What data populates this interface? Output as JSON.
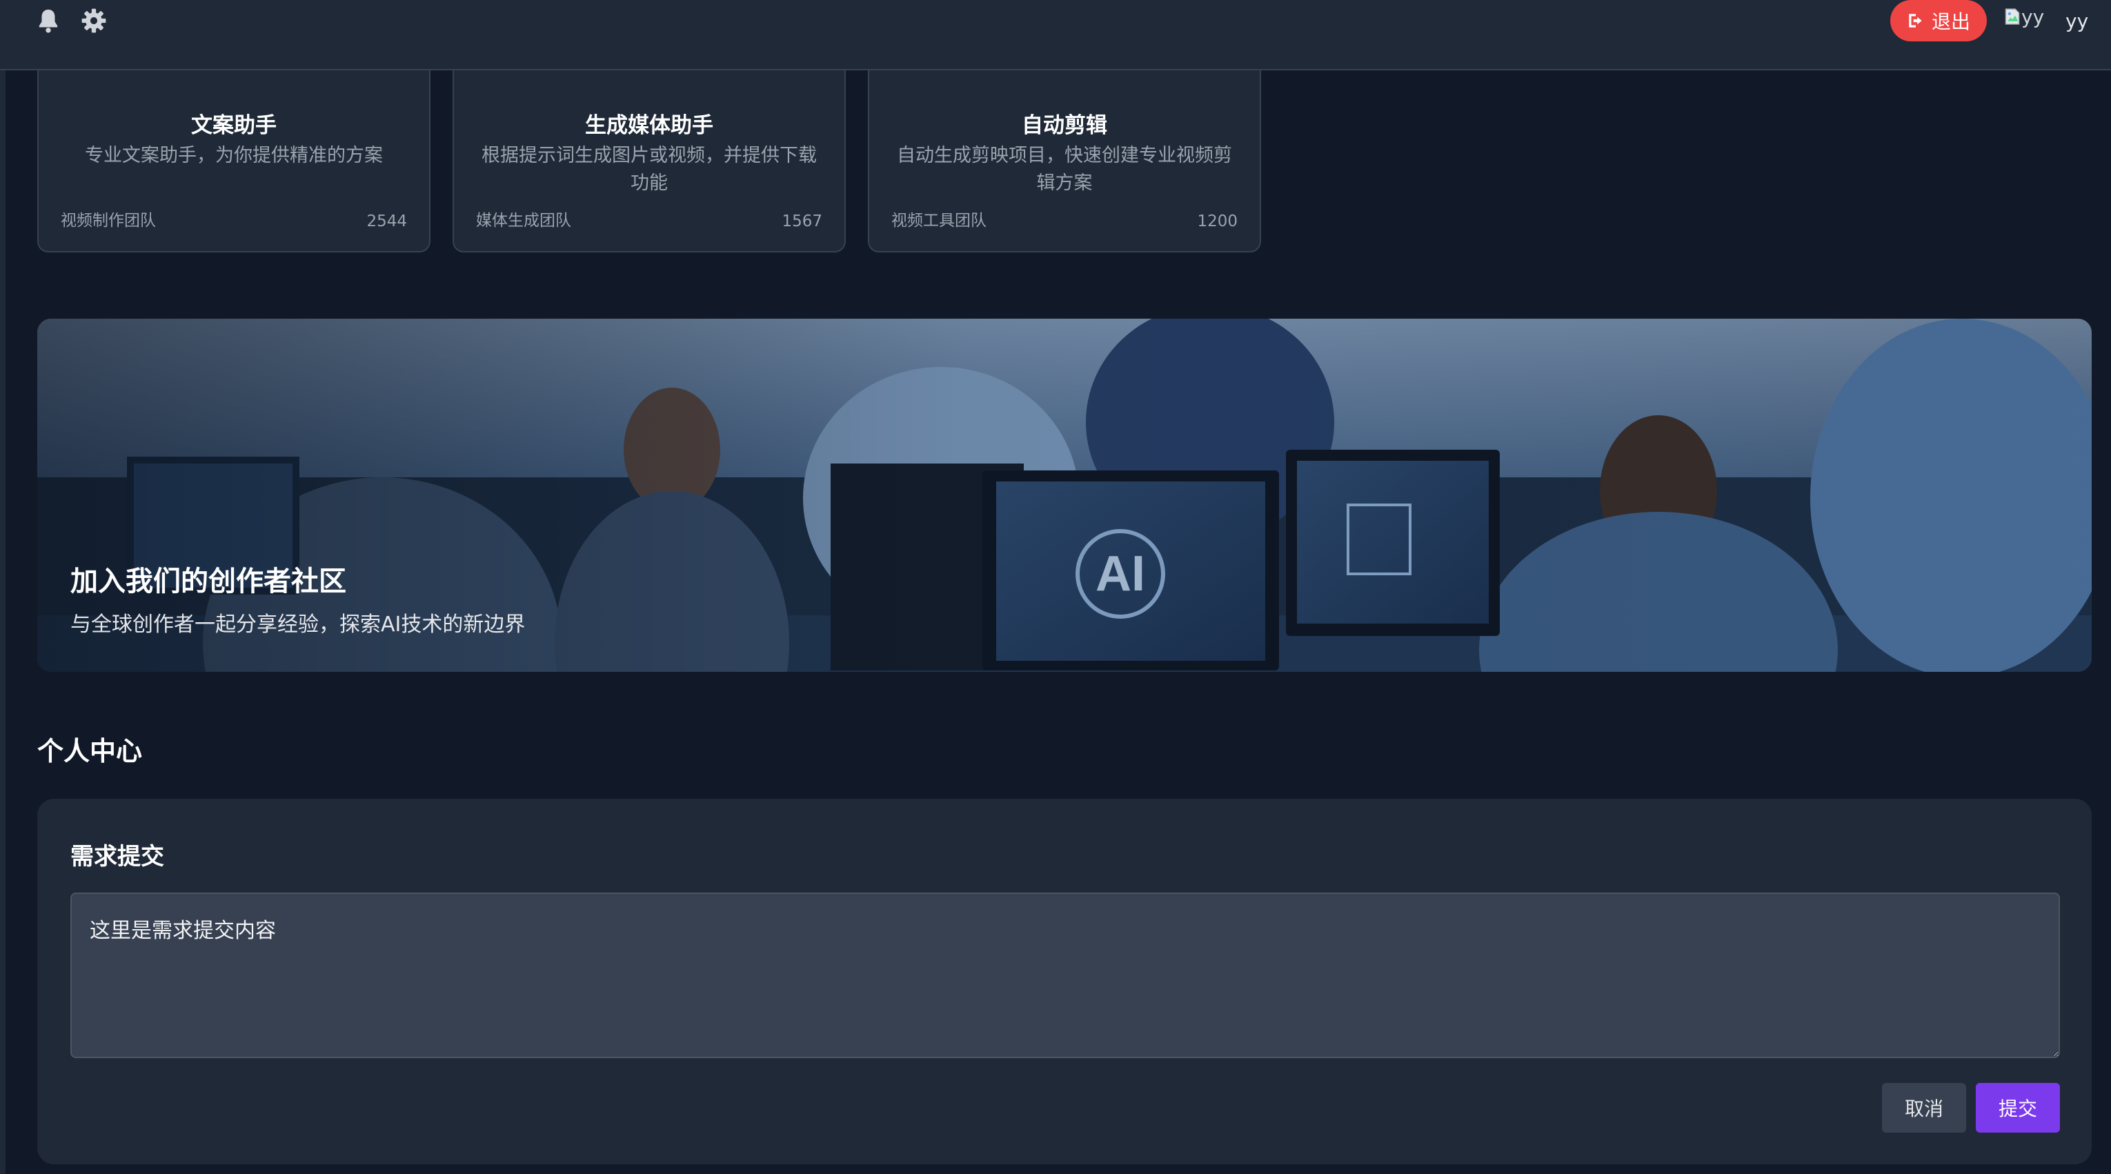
{
  "header": {
    "logout_label": "退出",
    "avatar_alt": "yy",
    "username": "yy"
  },
  "cards": [
    {
      "title": "文案助手",
      "description": "专业文案助手，为你提供精准的方案",
      "team": "视频制作团队",
      "count": "2544"
    },
    {
      "title": "生成媒体助手",
      "description": "根据提示词生成图片或视频，并提供下载功能",
      "team": "媒体生成团队",
      "count": "1567"
    },
    {
      "title": "自动剪辑",
      "description": "自动生成剪映项目，快速创建专业视频剪辑方案",
      "team": "视频工具团队",
      "count": "1200"
    }
  ],
  "banner": {
    "title": "加入我们的创作者社区",
    "subtitle": "与全球创作者一起分享经验，探索AI技术的新边界",
    "screen_text": "AI"
  },
  "section": {
    "title": "个人中心"
  },
  "request_form": {
    "title": "需求提交",
    "value": "这里是需求提交内容",
    "cancel_label": "取消",
    "submit_label": "提交"
  },
  "colors": {
    "background": "#111827",
    "surface": "#1f2937",
    "danger": "#ef4444",
    "accent": "#7c3aed"
  }
}
